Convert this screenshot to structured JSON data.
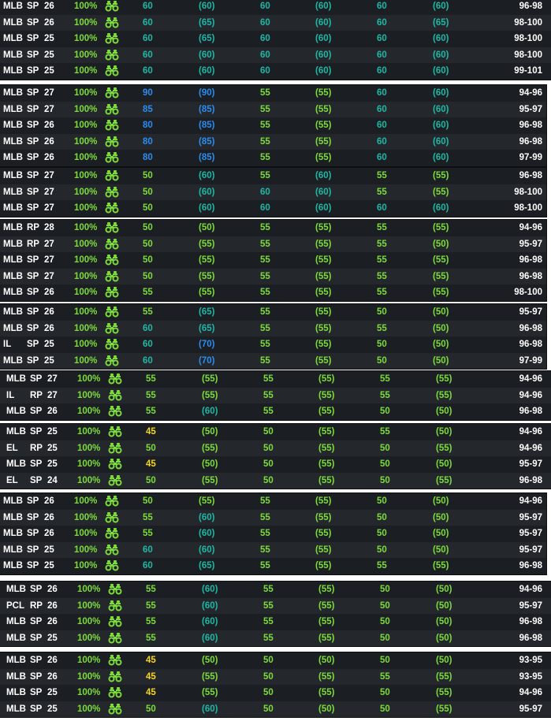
{
  "colors": {
    "yellow": "#f5d623",
    "lightgreen": "#7ddc3a",
    "teal": "#1fb8a6",
    "blue": "#2b8df0",
    "row_bg": "#1b1e22",
    "row_alt": "#24282c"
  },
  "icons": {
    "scout": "binoculars-icon"
  },
  "groups": [
    {
      "rows": [
        {
          "lvl": "MLB",
          "pos": "SP",
          "age": "26",
          "pct": "100%",
          "p1": {
            "c": "60",
            "f": "(60)"
          },
          "p2": {
            "c": "60",
            "f": "(60)"
          },
          "p3": {
            "c": "60",
            "f": "(60)"
          },
          "velo": "96-98"
        },
        {
          "lvl": "MLB",
          "pos": "SP",
          "age": "26",
          "pct": "100%",
          "p1": {
            "c": "60",
            "f": "(65)"
          },
          "p2": {
            "c": "60",
            "f": "(60)"
          },
          "p3": {
            "c": "60",
            "f": "(65)"
          },
          "velo": "98-100"
        },
        {
          "lvl": "MLB",
          "pos": "SP",
          "age": "25",
          "pct": "100%",
          "p1": {
            "c": "60",
            "f": "(65)"
          },
          "p2": {
            "c": "60",
            "f": "(60)"
          },
          "p3": {
            "c": "60",
            "f": "(60)"
          },
          "velo": "98-100"
        },
        {
          "lvl": "MLB",
          "pos": "SP",
          "age": "25",
          "pct": "100%",
          "p1": {
            "c": "60",
            "f": "(60)"
          },
          "p2": {
            "c": "60",
            "f": "(60)"
          },
          "p3": {
            "c": "60",
            "f": "(60)"
          },
          "velo": "98-100"
        },
        {
          "lvl": "MLB",
          "pos": "SP",
          "age": "25",
          "pct": "100%",
          "p1": {
            "c": "60",
            "f": "(60)"
          },
          "p2": {
            "c": "60",
            "f": "(60)"
          },
          "p3": {
            "c": "60",
            "f": "(60)"
          },
          "velo": "99-101"
        }
      ]
    },
    {
      "rows": [
        {
          "lvl": "MLB",
          "pos": "SP",
          "age": "27",
          "pct": "100%",
          "p1": {
            "c": "90",
            "f": "(90)"
          },
          "p2": {
            "c": "55",
            "f": "(55)"
          },
          "p3": {
            "c": "60",
            "f": "(60)"
          },
          "velo": "94-96"
        },
        {
          "lvl": "MLB",
          "pos": "SP",
          "age": "27",
          "pct": "100%",
          "p1": {
            "c": "85",
            "f": "(85)"
          },
          "p2": {
            "c": "55",
            "f": "(55)"
          },
          "p3": {
            "c": "60",
            "f": "(60)"
          },
          "velo": "95-97"
        },
        {
          "lvl": "MLB",
          "pos": "SP",
          "age": "26",
          "pct": "100%",
          "p1": {
            "c": "80",
            "f": "(85)"
          },
          "p2": {
            "c": "55",
            "f": "(55)"
          },
          "p3": {
            "c": "60",
            "f": "(60)"
          },
          "velo": "96-98"
        },
        {
          "lvl": "MLB",
          "pos": "SP",
          "age": "26",
          "pct": "100%",
          "p1": {
            "c": "80",
            "f": "(85)"
          },
          "p2": {
            "c": "55",
            "f": "(55)"
          },
          "p3": {
            "c": "60",
            "f": "(60)"
          },
          "velo": "96-98"
        },
        {
          "lvl": "MLB",
          "pos": "SP",
          "age": "26",
          "pct": "100%",
          "p1": {
            "c": "80",
            "f": "(85)"
          },
          "p2": {
            "c": "55",
            "f": "(55)"
          },
          "p3": {
            "c": "60",
            "f": "(60)"
          },
          "velo": "97-99"
        }
      ]
    },
    {
      "rows": [
        {
          "lvl": "MLB",
          "pos": "SP",
          "age": "27",
          "pct": "100%",
          "p1": {
            "c": "50",
            "f": "(60)"
          },
          "p2": {
            "c": "55",
            "f": "(60)"
          },
          "p3": {
            "c": "55",
            "f": "(55)"
          },
          "velo": "96-98"
        },
        {
          "lvl": "MLB",
          "pos": "SP",
          "age": "27",
          "pct": "100%",
          "p1": {
            "c": "50",
            "f": "(60)"
          },
          "p2": {
            "c": "60",
            "f": "(60)"
          },
          "p3": {
            "c": "55",
            "f": "(55)"
          },
          "velo": "98-100"
        },
        {
          "lvl": "MLB",
          "pos": "SP",
          "age": "27",
          "pct": "100%",
          "p1": {
            "c": "50",
            "f": "(60)"
          },
          "p2": {
            "c": "60",
            "f": "(60)"
          },
          "p3": {
            "c": "60",
            "f": "(60)"
          },
          "velo": "98-100"
        }
      ]
    },
    {
      "rows": [
        {
          "lvl": "MLB",
          "pos": "RP",
          "age": "28",
          "pct": "100%",
          "p1": {
            "c": "50",
            "f": "(50)"
          },
          "p2": {
            "c": "55",
            "f": "(55)"
          },
          "p3": {
            "c": "55",
            "f": "(55)"
          },
          "velo": "94-96"
        },
        {
          "lvl": "MLB",
          "pos": "RP",
          "age": "27",
          "pct": "100%",
          "p1": {
            "c": "50",
            "f": "(55)"
          },
          "p2": {
            "c": "55",
            "f": "(55)"
          },
          "p3": {
            "c": "55",
            "f": "(50)"
          },
          "velo": "95-97"
        },
        {
          "lvl": "MLB",
          "pos": "SP",
          "age": "27",
          "pct": "100%",
          "p1": {
            "c": "50",
            "f": "(55)"
          },
          "p2": {
            "c": "55",
            "f": "(55)"
          },
          "p3": {
            "c": "55",
            "f": "(55)"
          },
          "velo": "96-98"
        },
        {
          "lvl": "MLB",
          "pos": "SP",
          "age": "27",
          "pct": "100%",
          "p1": {
            "c": "50",
            "f": "(55)"
          },
          "p2": {
            "c": "55",
            "f": "(55)"
          },
          "p3": {
            "c": "55",
            "f": "(55)"
          },
          "velo": "96-98"
        },
        {
          "lvl": "MLB",
          "pos": "SP",
          "age": "26",
          "pct": "100%",
          "p1": {
            "c": "55",
            "f": "(55)"
          },
          "p2": {
            "c": "55",
            "f": "(55)"
          },
          "p3": {
            "c": "55",
            "f": "(55)"
          },
          "velo": "98-100"
        }
      ]
    },
    {
      "rows": [
        {
          "lvl": "MLB",
          "pos": "SP",
          "age": "26",
          "pct": "100%",
          "p1": {
            "c": "55",
            "f": "(65)"
          },
          "p2": {
            "c": "55",
            "f": "(55)"
          },
          "p3": {
            "c": "50",
            "f": "(50)"
          },
          "velo": "95-97"
        },
        {
          "lvl": "MLB",
          "pos": "SP",
          "age": "26",
          "pct": "100%",
          "p1": {
            "c": "60",
            "f": "(65)"
          },
          "p2": {
            "c": "55",
            "f": "(55)"
          },
          "p3": {
            "c": "55",
            "f": "(50)"
          },
          "velo": "96-98"
        },
        {
          "lvl": "IL",
          "pos": "SP",
          "age": "25",
          "pct": "100%",
          "p1": {
            "c": "60",
            "f": "(70)"
          },
          "p2": {
            "c": "55",
            "f": "(55)"
          },
          "p3": {
            "c": "50",
            "f": "(50)"
          },
          "velo": "96-98"
        },
        {
          "lvl": "MLB",
          "pos": "SP",
          "age": "25",
          "pct": "100%",
          "p1": {
            "c": "60",
            "f": "(70)"
          },
          "p2": {
            "c": "55",
            "f": "(55)"
          },
          "p3": {
            "c": "50",
            "f": "(50)"
          },
          "velo": "97-99"
        }
      ]
    },
    {
      "rows": [
        {
          "lvl": "MLB",
          "pos": "SP",
          "age": "27",
          "pct": "100%",
          "p1": {
            "c": "55",
            "f": "(55)"
          },
          "p2": {
            "c": "55",
            "f": "(55)"
          },
          "p3": {
            "c": "55",
            "f": "(55)"
          },
          "velo": "94-96"
        },
        {
          "lvl": "IL",
          "pos": "RP",
          "age": "27",
          "pct": "100%",
          "p1": {
            "c": "55",
            "f": "(55)"
          },
          "p2": {
            "c": "55",
            "f": "(55)"
          },
          "p3": {
            "c": "55",
            "f": "(55)"
          },
          "velo": "94-96"
        },
        {
          "lvl": "MLB",
          "pos": "SP",
          "age": "26",
          "pct": "100%",
          "p1": {
            "c": "55",
            "f": "(60)"
          },
          "p2": {
            "c": "55",
            "f": "(55)"
          },
          "p3": {
            "c": "50",
            "f": "(50)"
          },
          "velo": "96-98"
        }
      ]
    },
    {
      "rows": [
        {
          "lvl": "MLB",
          "pos": "SP",
          "age": "25",
          "pct": "100%",
          "p1": {
            "c": "45",
            "f": "(50)"
          },
          "p2": {
            "c": "50",
            "f": "(55)"
          },
          "p3": {
            "c": "55",
            "f": "(50)"
          },
          "velo": "94-96"
        },
        {
          "lvl": "EL",
          "pos": "RP",
          "age": "25",
          "pct": "100%",
          "p1": {
            "c": "50",
            "f": "(55)"
          },
          "p2": {
            "c": "50",
            "f": "(55)"
          },
          "p3": {
            "c": "50",
            "f": "(55)"
          },
          "velo": "94-96"
        },
        {
          "lvl": "MLB",
          "pos": "SP",
          "age": "25",
          "pct": "100%",
          "p1": {
            "c": "45",
            "f": "(50)"
          },
          "p2": {
            "c": "50",
            "f": "(55)"
          },
          "p3": {
            "c": "50",
            "f": "(50)"
          },
          "velo": "95-97"
        },
        {
          "lvl": "EL",
          "pos": "SP",
          "age": "24",
          "pct": "100%",
          "p1": {
            "c": "50",
            "f": "(55)"
          },
          "p2": {
            "c": "50",
            "f": "(55)"
          },
          "p3": {
            "c": "50",
            "f": "(55)"
          },
          "velo": "96-98"
        }
      ]
    },
    {
      "rows": [
        {
          "lvl": "MLB",
          "pos": "SP",
          "age": "26",
          "pct": "100%",
          "p1": {
            "c": "50",
            "f": "(55)"
          },
          "p2": {
            "c": "55",
            "f": "(55)"
          },
          "p3": {
            "c": "50",
            "f": "(50)"
          },
          "velo": "94-96"
        },
        {
          "lvl": "MLB",
          "pos": "SP",
          "age": "26",
          "pct": "100%",
          "p1": {
            "c": "55",
            "f": "(60)"
          },
          "p2": {
            "c": "55",
            "f": "(55)"
          },
          "p3": {
            "c": "50",
            "f": "(50)"
          },
          "velo": "95-97"
        },
        {
          "lvl": "MLB",
          "pos": "SP",
          "age": "26",
          "pct": "100%",
          "p1": {
            "c": "55",
            "f": "(60)"
          },
          "p2": {
            "c": "55",
            "f": "(55)"
          },
          "p3": {
            "c": "50",
            "f": "(50)"
          },
          "velo": "95-97"
        },
        {
          "lvl": "MLB",
          "pos": "SP",
          "age": "25",
          "pct": "100%",
          "p1": {
            "c": "60",
            "f": "(60)"
          },
          "p2": {
            "c": "55",
            "f": "(55)"
          },
          "p3": {
            "c": "50",
            "f": "(50)"
          },
          "velo": "95-97"
        },
        {
          "lvl": "MLB",
          "pos": "SP",
          "age": "25",
          "pct": "100%",
          "p1": {
            "c": "60",
            "f": "(65)"
          },
          "p2": {
            "c": "55",
            "f": "(55)"
          },
          "p3": {
            "c": "55",
            "f": "(55)"
          },
          "velo": "96-98"
        }
      ]
    },
    {
      "rows": [
        {
          "lvl": "MLB",
          "pos": "SP",
          "age": "26",
          "pct": "100%",
          "p1": {
            "c": "55",
            "f": "(60)"
          },
          "p2": {
            "c": "55",
            "f": "(55)"
          },
          "p3": {
            "c": "50",
            "f": "(50)"
          },
          "velo": "94-96"
        },
        {
          "lvl": "PCL",
          "pos": "RP",
          "age": "26",
          "pct": "100%",
          "p1": {
            "c": "55",
            "f": "(60)"
          },
          "p2": {
            "c": "55",
            "f": "(55)"
          },
          "p3": {
            "c": "50",
            "f": "(50)"
          },
          "velo": "95-97"
        },
        {
          "lvl": "MLB",
          "pos": "SP",
          "age": "26",
          "pct": "100%",
          "p1": {
            "c": "55",
            "f": "(60)"
          },
          "p2": {
            "c": "55",
            "f": "(55)"
          },
          "p3": {
            "c": "50",
            "f": "(50)"
          },
          "velo": "96-98"
        },
        {
          "lvl": "MLB",
          "pos": "SP",
          "age": "25",
          "pct": "100%",
          "p1": {
            "c": "55",
            "f": "(60)"
          },
          "p2": {
            "c": "55",
            "f": "(55)"
          },
          "p3": {
            "c": "50",
            "f": "(50)"
          },
          "velo": "96-98"
        }
      ]
    },
    {
      "rows": [
        {
          "lvl": "MLB",
          "pos": "SP",
          "age": "26",
          "pct": "100%",
          "p1": {
            "c": "45",
            "f": "(50)"
          },
          "p2": {
            "c": "50",
            "f": "(50)"
          },
          "p3": {
            "c": "50",
            "f": "(50)"
          },
          "velo": "93-95"
        },
        {
          "lvl": "MLB",
          "pos": "SP",
          "age": "26",
          "pct": "100%",
          "p1": {
            "c": "45",
            "f": "(55)"
          },
          "p2": {
            "c": "50",
            "f": "(55)"
          },
          "p3": {
            "c": "55",
            "f": "(55)"
          },
          "velo": "93-95"
        },
        {
          "lvl": "MLB",
          "pos": "SP",
          "age": "25",
          "pct": "100%",
          "p1": {
            "c": "45",
            "f": "(55)"
          },
          "p2": {
            "c": "50",
            "f": "(55)"
          },
          "p3": {
            "c": "50",
            "f": "(55)"
          },
          "velo": "94-96"
        },
        {
          "lvl": "MLB",
          "pos": "SP",
          "age": "25",
          "pct": "100%",
          "p1": {
            "c": "50",
            "f": "(60)"
          },
          "p2": {
            "c": "50",
            "f": "(50)"
          },
          "p3": {
            "c": "50",
            "f": "(55)"
          },
          "velo": "95-97"
        }
      ]
    }
  ]
}
